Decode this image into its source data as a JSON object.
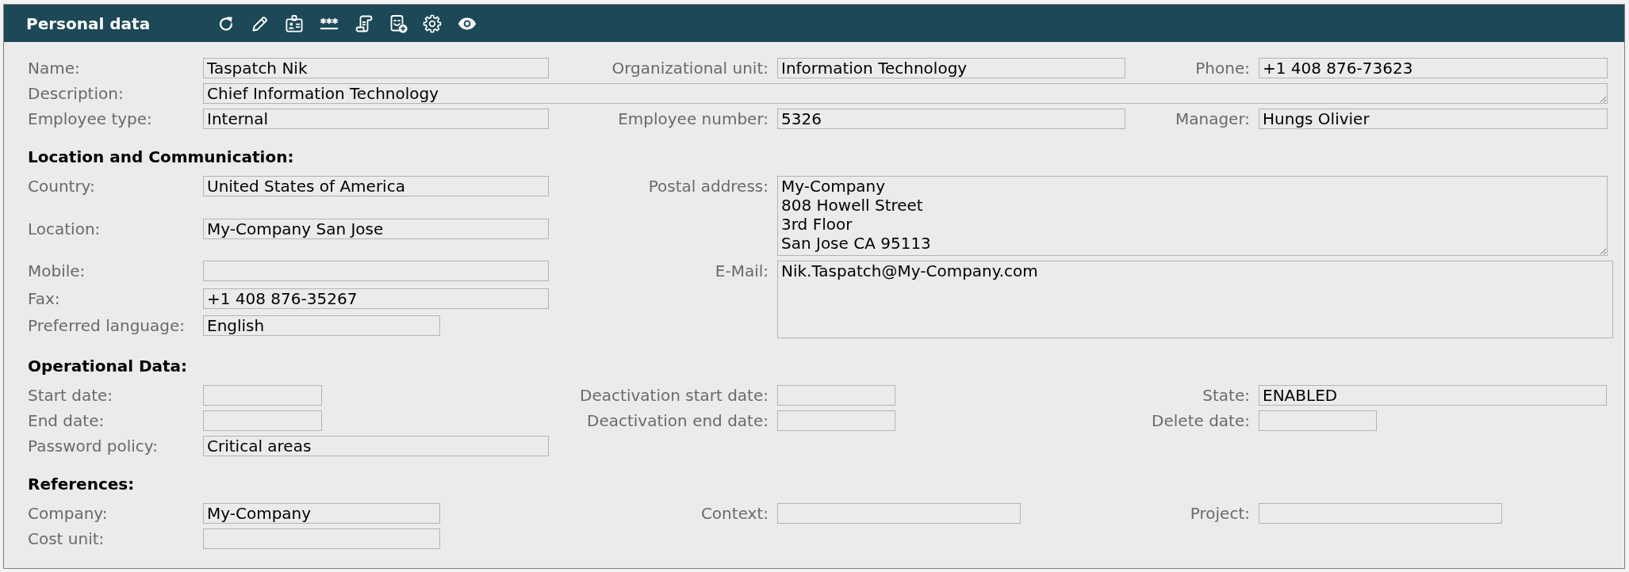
{
  "header": {
    "title": "Personal data"
  },
  "sections": [
    {
      "fields": [
        {
          "label": "Name:",
          "value": "Taspatch Nik",
          "kind": "text"
        },
        {
          "label": "Organizational unit:",
          "value": "Information Technology",
          "kind": "text"
        },
        {
          "label": "Phone:",
          "value": "+1 408 876-73623",
          "kind": "text"
        },
        {
          "label": "Description:",
          "value": "Chief Information Technology",
          "kind": "textarea"
        },
        {
          "label": "Employee type:",
          "value": "Internal",
          "kind": "text"
        },
        {
          "label": "Employee number:",
          "value": "5326",
          "kind": "text"
        },
        {
          "label": "Manager:",
          "value": "Hungs Olivier",
          "kind": "text"
        }
      ]
    },
    {
      "heading": "Location and Communication:",
      "fields": [
        {
          "label": "Country:",
          "value": "United States of America",
          "kind": "text"
        },
        {
          "label": "Postal address:",
          "value": "My-Company\n808 Howell Street\n3rd Floor\nSan Jose CA 95113",
          "kind": "textarea"
        },
        {
          "label": "Location:",
          "value": "My-Company San Jose",
          "kind": "text"
        },
        {
          "label": "Mobile:",
          "kind": "text"
        },
        {
          "label": "E-Mail:",
          "value": "Nik.Taspatch@My-Company.com",
          "kind": "listbox"
        },
        {
          "label": "Fax:",
          "value": "+1 408 876-35267",
          "kind": "text"
        },
        {
          "label": "Preferred language:",
          "value": "English",
          "kind": "text"
        }
      ]
    },
    {
      "heading": "Operational Data:",
      "fields": [
        {
          "label": "Start date:",
          "kind": "text"
        },
        {
          "label": "Deactivation start date:",
          "kind": "text"
        },
        {
          "label": "State:",
          "value": "ENABLED",
          "kind": "text"
        },
        {
          "label": "End date:",
          "kind": "text"
        },
        {
          "label": "Deactivation end date:",
          "kind": "text"
        },
        {
          "label": "Delete date:",
          "kind": "text"
        },
        {
          "label": "Password policy:",
          "value": "Critical areas",
          "kind": "text"
        }
      ]
    },
    {
      "heading": "References:",
      "fields": [
        {
          "label": "Company:",
          "value": "My-Company",
          "kind": "text"
        },
        {
          "label": "Context:",
          "kind": "text"
        },
        {
          "label": "Project:",
          "kind": "text"
        },
        {
          "label": "Cost unit:",
          "kind": "text"
        }
      ]
    }
  ]
}
